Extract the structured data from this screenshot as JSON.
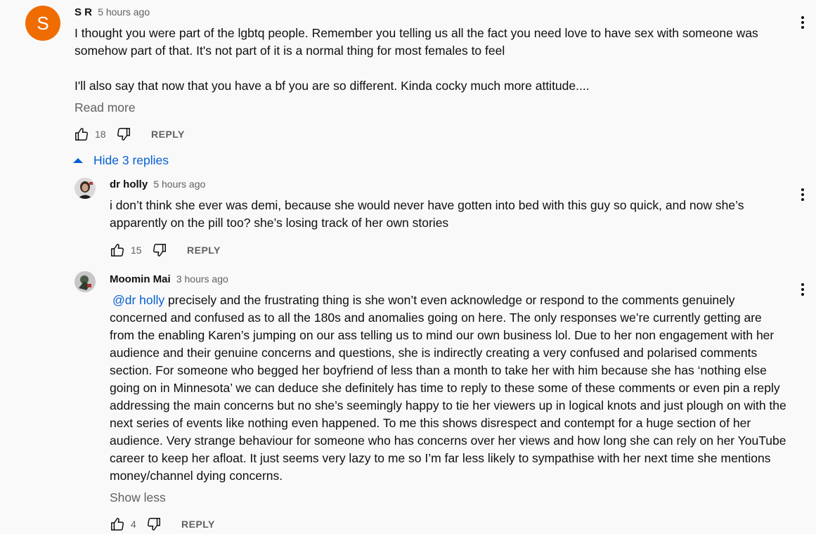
{
  "comment": {
    "avatar_letter": "S",
    "avatar_color": "#ef6c00",
    "author": "S R",
    "time": "5 hours ago",
    "text_p1": "I thought you were part of the lgbtq people. Remember you telling us all the fact you need love to have sex with someone was somehow part of that.  It's not part of it is a normal thing for most females to feel",
    "text_p2": "I'll also say that now that you have a bf you are so different. Kinda cocky much more attitude....",
    "read_more": "Read more",
    "likes": "18",
    "reply_label": "REPLY"
  },
  "replies_toggle": {
    "label": "Hide 3 replies"
  },
  "replies": [
    {
      "author": "dr holly",
      "time": "5 hours ago",
      "text": "i don’t think she ever was demi, because she would never have gotten into bed with this guy so quick, and now she’s apparently on the pill too? she’s losing track of her own stories",
      "likes": "15",
      "reply_label": "REPLY"
    },
    {
      "author": "Moomin Mai",
      "time": "3 hours ago",
      "mention": "@dr holly",
      "text": " precisely and the frustrating thing is she won’t even acknowledge or respond to the comments genuinely concerned and confused as to all the 180s and anomalies going on here. The only responses we’re currently getting are from the enabling Karen’s jumping on our ass telling us to mind our own business lol. Due to her non engagement with her audience and their genuine concerns and questions, she is indirectly creating a very confused and polarised comments section. For someone who begged her boyfriend of less than a month to take her with him because she has ‘nothing else going on in Minnesota’ we can deduce she definitely has time to reply to these some of these comments or even pin a reply addressing the main concerns but no she’s seemingly happy to tie her viewers up in logical knots and just plough on with the next series of events like nothing even happened. To me this shows disrespect and contempt for a huge section of her audience. Very strange behaviour for someone who has concerns over her views and how long she can rely on her YouTube career to keep her afloat. It just seems very lazy to me so I’m far less likely to sympathise with her next time she mentions money/channel dying concerns.",
      "show_less": "Show less",
      "likes": "4",
      "reply_label": "REPLY"
    }
  ],
  "colors": {
    "link": "#065fd4",
    "secondary_text": "#606060",
    "background": "#f9f9f9"
  },
  "icons": {
    "like": "thumbs-up-icon",
    "dislike": "thumbs-down-icon",
    "menu": "more-vert-icon",
    "collapse": "caret-up-icon"
  }
}
